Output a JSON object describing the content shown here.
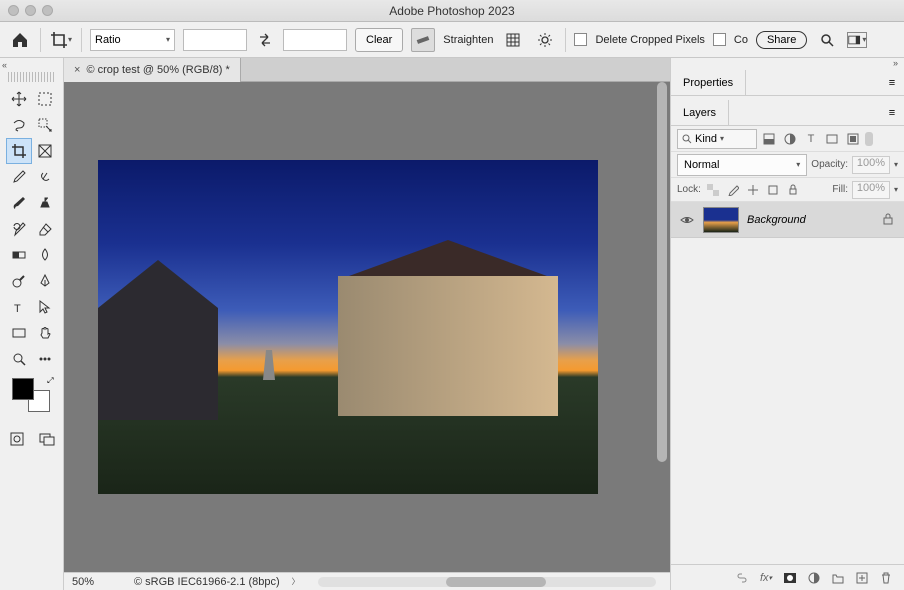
{
  "title_bar": {
    "app_title": "Adobe Photoshop 2023"
  },
  "options_bar": {
    "ratio_mode": "Ratio",
    "width": "",
    "height": "",
    "clear_label": "Clear",
    "straighten_label": "Straighten",
    "delete_cropped_label": "Delete Cropped Pixels",
    "content_aware_label": "Co",
    "share_label": "Share"
  },
  "document_tab": {
    "title": "© crop test @ 50% (RGB/8) *"
  },
  "status_bar": {
    "zoom": "50%",
    "info": "© sRGB IEC61966-2.1 (8bpc)"
  },
  "panels": {
    "properties_tab": "Properties",
    "layers_tab": "Layers",
    "filter_kind": "Kind",
    "blend_mode": "Normal",
    "opacity_label": "Opacity:",
    "opacity_value": "100%",
    "lock_label": "Lock:",
    "fill_label": "Fill:",
    "fill_value": "100%",
    "layers": [
      {
        "name": "Background",
        "visible": true,
        "locked": true
      }
    ]
  },
  "tools": {
    "left": [
      [
        "move",
        "artboard"
      ],
      [
        "lasso",
        "quick-select"
      ],
      [
        "crop",
        "frame"
      ],
      [
        "eyedropper",
        "healing"
      ],
      [
        "brush",
        "clone"
      ],
      [
        "history-brush",
        "eraser"
      ],
      [
        "gradient",
        "blur"
      ],
      [
        "dodge",
        "pen"
      ],
      [
        "type",
        "path-select"
      ],
      [
        "rectangle",
        "hand"
      ],
      [
        "zoom",
        "more"
      ]
    ],
    "selected": "crop"
  },
  "icons": {
    "home": "home",
    "crop": "crop",
    "swap": "swap",
    "straighten": "ruler",
    "grid": "grid",
    "gear": "gear",
    "search": "search",
    "eye": "eye",
    "lock": "lock",
    "link": "link",
    "fx": "fx",
    "mask": "mask",
    "adjust": "adjust",
    "folder": "folder",
    "new": "new",
    "trash": "trash"
  }
}
